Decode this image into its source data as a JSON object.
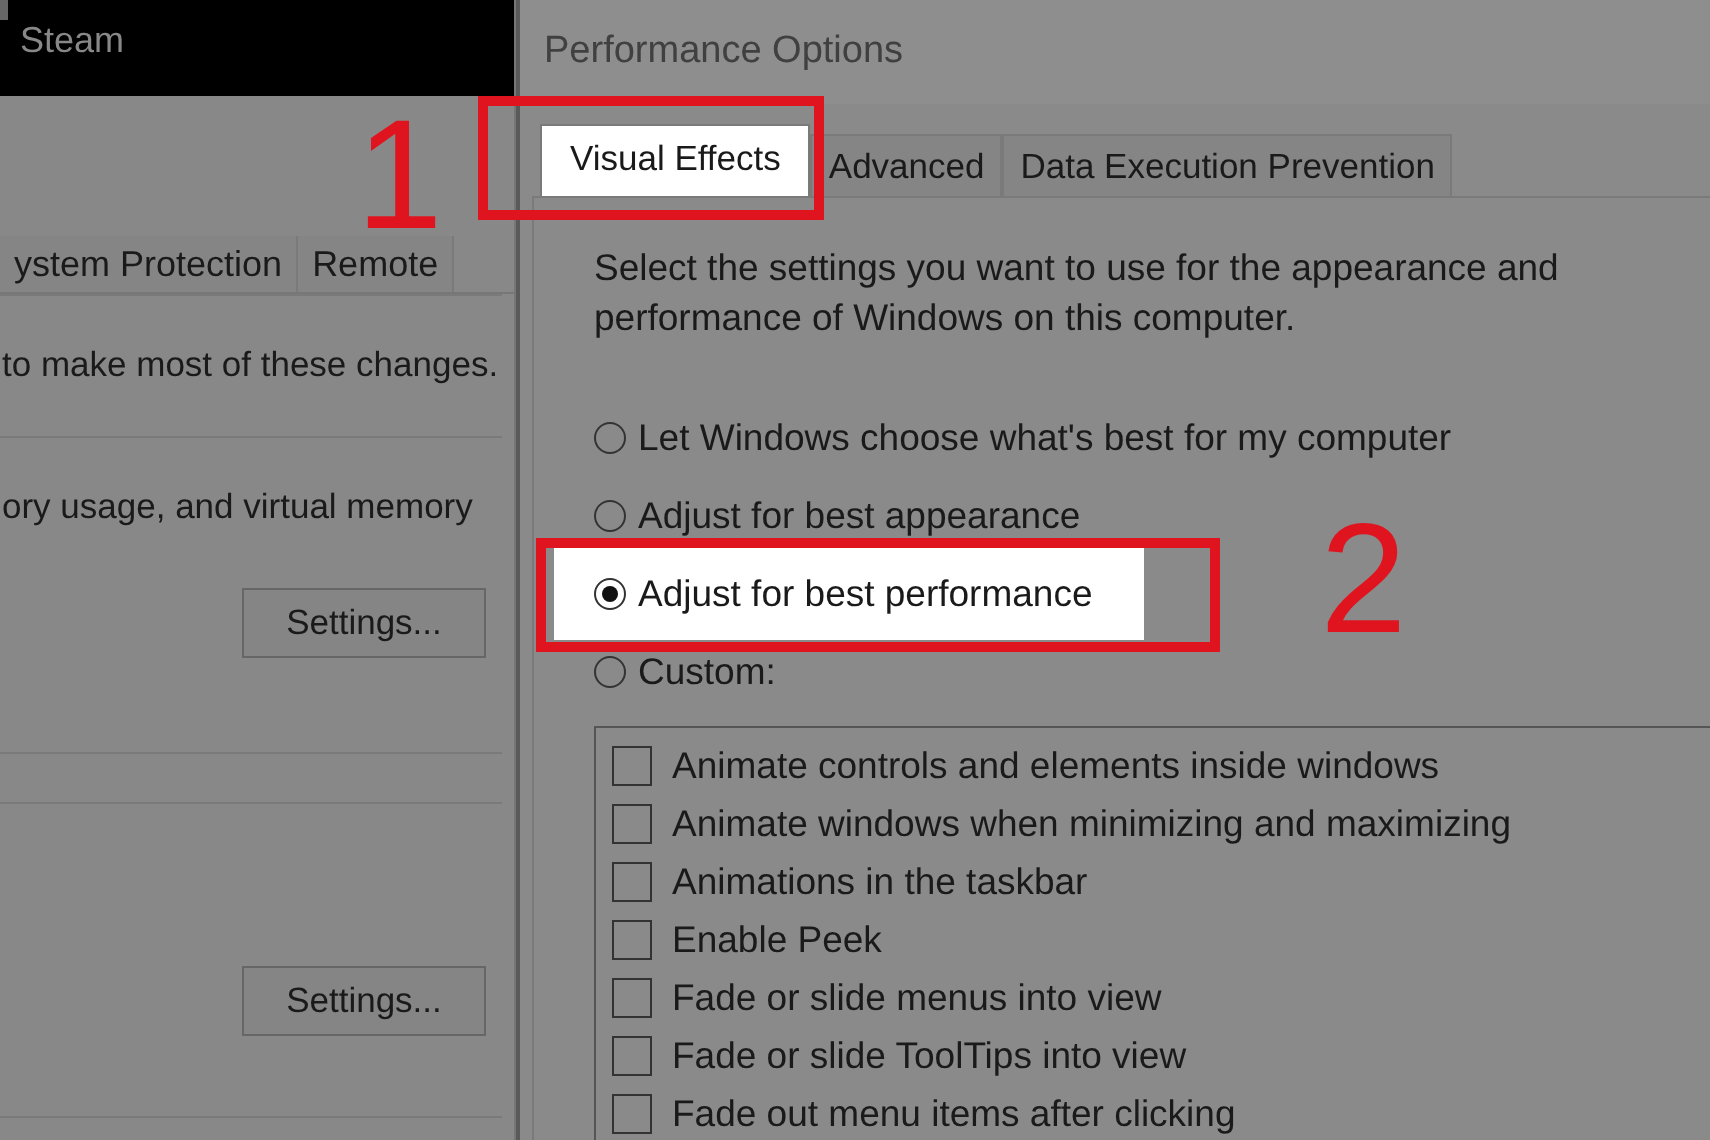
{
  "left_window": {
    "title": "Steam",
    "tabs": [
      {
        "label": "ystem Protection",
        "selected": false
      },
      {
        "label": "Remote",
        "selected": false
      }
    ],
    "texts": [
      "to make most of these changes.",
      "ory usage, and virtual memory"
    ],
    "buttons": [
      "Settings...",
      "Settings..."
    ]
  },
  "dialog": {
    "title": "Performance Options",
    "tabs": [
      {
        "label": "Visual Effects",
        "selected": true
      },
      {
        "label": "Advanced",
        "selected": false
      },
      {
        "label": "Data Execution Prevention",
        "selected": false
      }
    ],
    "description": "Select the settings you want to use for the appearance and performance of Windows on this computer.",
    "options": [
      {
        "label": "Let Windows choose what's best for my computer",
        "selected": false
      },
      {
        "label": "Adjust for best appearance",
        "selected": false
      },
      {
        "label": "Adjust for best performance",
        "selected": true
      },
      {
        "label": "Custom:",
        "selected": false
      }
    ],
    "effects": [
      {
        "label": "Animate controls and elements inside windows",
        "checked": false
      },
      {
        "label": "Animate windows when minimizing and maximizing",
        "checked": false
      },
      {
        "label": "Animations in the taskbar",
        "checked": false
      },
      {
        "label": "Enable Peek",
        "checked": false
      },
      {
        "label": "Fade or slide menus into view",
        "checked": false
      },
      {
        "label": "Fade or slide ToolTips into view",
        "checked": false
      },
      {
        "label": "Fade out menu items after clicking",
        "checked": false
      }
    ]
  },
  "annotations": [
    {
      "label": "1"
    },
    {
      "label": "2"
    }
  ]
}
